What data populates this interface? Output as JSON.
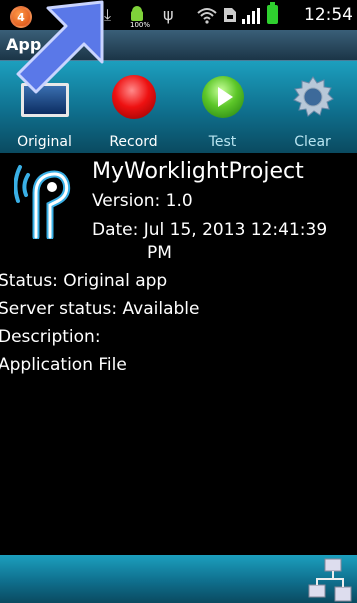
{
  "status_bar": {
    "notification_count": "4",
    "time": "12:54",
    "battery_percent": "100%",
    "icons": [
      "notification-badge-icon",
      "download-icon",
      "android-icon",
      "usb-icon",
      "wifi-icon",
      "sd-card-icon",
      "signal-bars-icon",
      "battery-icon"
    ]
  },
  "titlebar": {
    "title": "App"
  },
  "toolbar": {
    "items": [
      {
        "label": "Original",
        "icon": "screen-icon"
      },
      {
        "label": "Record",
        "icon": "record-icon"
      },
      {
        "label": "Test",
        "icon": "play-icon"
      },
      {
        "label": "Clear",
        "icon": "gear-icon"
      }
    ]
  },
  "app": {
    "name": "MyWorklightProject",
    "version": "Version: 1.0",
    "date_line1": "Date: Jul 15, 2013 12:41:39",
    "date_line2": "PM",
    "status": "Status: Original app",
    "server_status": "Server status: Available",
    "description": "Description:",
    "file": "Application File"
  },
  "colors": {
    "toolbar_top": "#1c9fbe",
    "toolbar_bottom": "#0a4a60",
    "background": "#000000",
    "arrow_fill": "#5a78e8"
  }
}
